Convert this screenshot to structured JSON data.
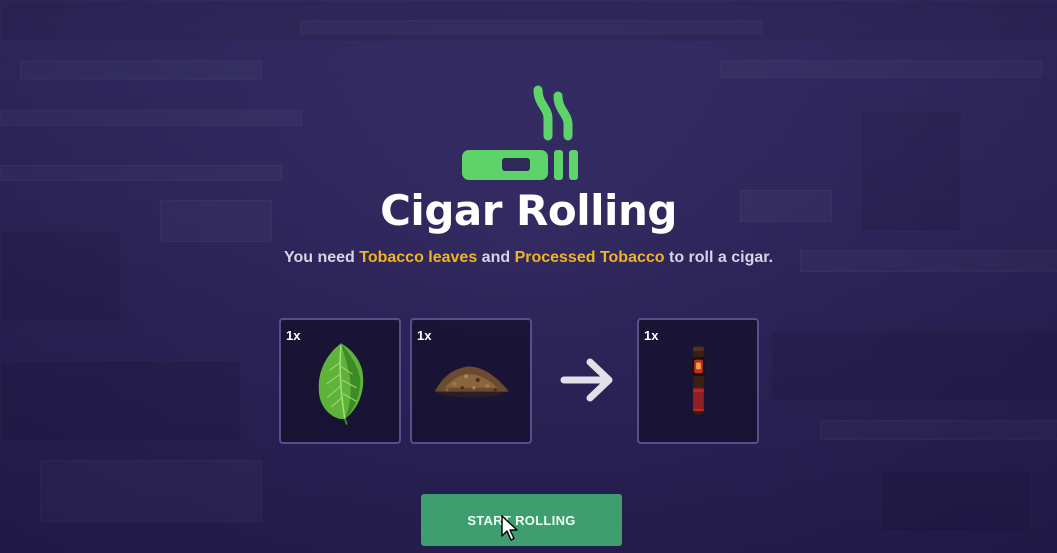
{
  "dialog": {
    "title": "Cigar Rolling",
    "subtitle": {
      "prefix": "You need ",
      "item1": "Tobacco leaves",
      "middle": " and ",
      "item2": "Processed Tobacco",
      "suffix": " to roll a cigar."
    }
  },
  "recipe": {
    "ingredients": [
      {
        "quantity": "1x",
        "icon": "tobacco-leaf-icon"
      },
      {
        "quantity": "1x",
        "icon": "processed-tobacco-icon"
      }
    ],
    "arrow_icon": "arrow-right-icon",
    "result": {
      "quantity": "1x",
      "icon": "cigar-icon"
    }
  },
  "actions": {
    "start_label": "START ROLLING"
  },
  "colors": {
    "accent_green": "#5ed36a",
    "highlight_yellow": "#f0b323",
    "button_green": "#3f9e6f",
    "slot_border": "#5b4c8c"
  }
}
